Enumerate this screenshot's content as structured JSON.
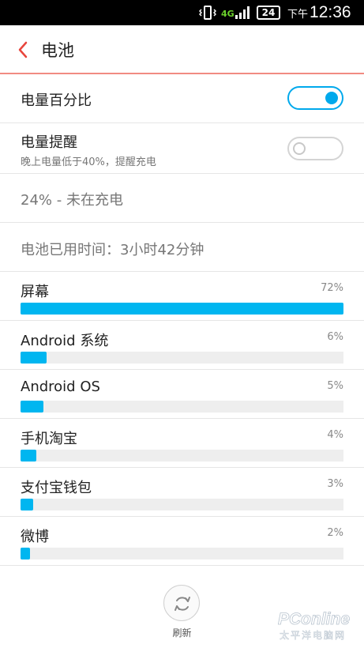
{
  "status_bar": {
    "network": "4G",
    "battery": "24",
    "ampm": "下午",
    "time": "12:36"
  },
  "header": {
    "title": "电池"
  },
  "settings": {
    "percentage": {
      "label": "电量百分比",
      "enabled": true
    },
    "reminder": {
      "label": "电量提醒",
      "subtitle": "晚上电量低于40%，提醒充电",
      "enabled": false
    }
  },
  "status_text": "24% - 未在充电",
  "usage_time": "电池已用时间：3小时42分钟",
  "usage": [
    {
      "name": "屏幕",
      "percent_label": "72%",
      "fraction": 1.0
    },
    {
      "name": "Android 系统",
      "percent_label": "6%",
      "fraction": 0.08
    },
    {
      "name": "Android OS",
      "percent_label": "5%",
      "fraction": 0.07
    },
    {
      "name": "手机淘宝",
      "percent_label": "4%",
      "fraction": 0.05
    },
    {
      "name": "支付宝钱包",
      "percent_label": "3%",
      "fraction": 0.04
    },
    {
      "name": "微博",
      "percent_label": "2%",
      "fraction": 0.03
    }
  ],
  "footer": {
    "refresh_label": "刷新"
  },
  "colors": {
    "accent": "#00a9ec",
    "bar": "#00b6f0",
    "header_rule": "#f18b82",
    "back_arrow": "#e8453c"
  },
  "watermark": {
    "brand": "PCONLINE",
    "caption": "太平洋电脑网"
  }
}
